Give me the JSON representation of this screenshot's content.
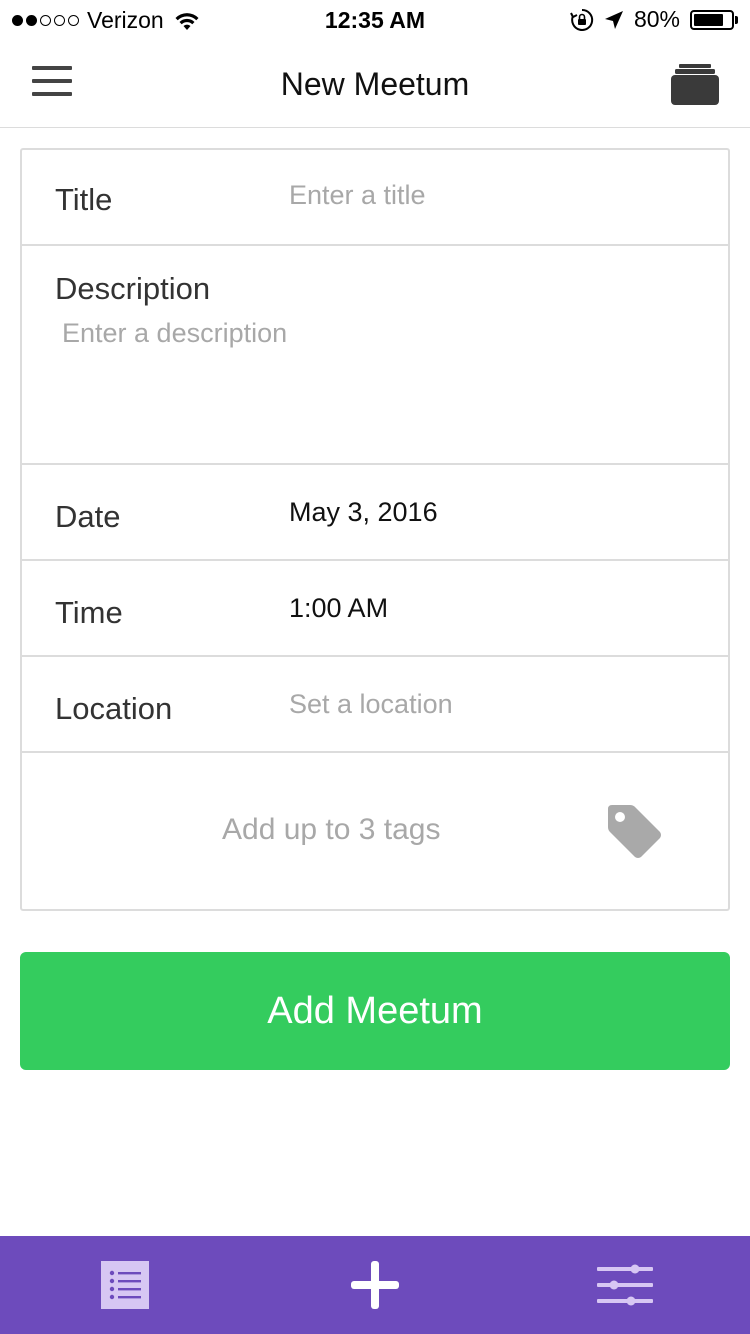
{
  "status_bar": {
    "carrier": "Verizon",
    "time": "12:35 AM",
    "battery_percent": "80%",
    "battery_level": 0.8,
    "signal_bars_filled": 2,
    "signal_bars_total": 5
  },
  "nav": {
    "title": "New Meetum",
    "left_icon": "menu-icon",
    "right_icon": "archive-icon"
  },
  "form": {
    "title": {
      "label": "Title",
      "placeholder": "Enter a title"
    },
    "description": {
      "label": "Description",
      "placeholder": "Enter a description"
    },
    "date": {
      "label": "Date",
      "value": "May 3, 2016"
    },
    "time": {
      "label": "Time",
      "value": "1:00 AM"
    },
    "location": {
      "label": "Location",
      "placeholder": "Set a location"
    },
    "tags": {
      "placeholder": "Add up to 3 tags",
      "icon": "tag-icon"
    }
  },
  "submit": {
    "label": "Add Meetum"
  },
  "tab_bar": {
    "tabs": [
      {
        "icon": "list-icon",
        "active": true
      },
      {
        "icon": "plus-icon",
        "active": false
      },
      {
        "icon": "sliders-icon",
        "active": false
      }
    ]
  },
  "colors": {
    "accent_green": "#34cc5e",
    "tab_bar_purple": "#6d4bbc",
    "placeholder_gray": "#a8a8a8",
    "border_gray": "#dcdcdc"
  }
}
